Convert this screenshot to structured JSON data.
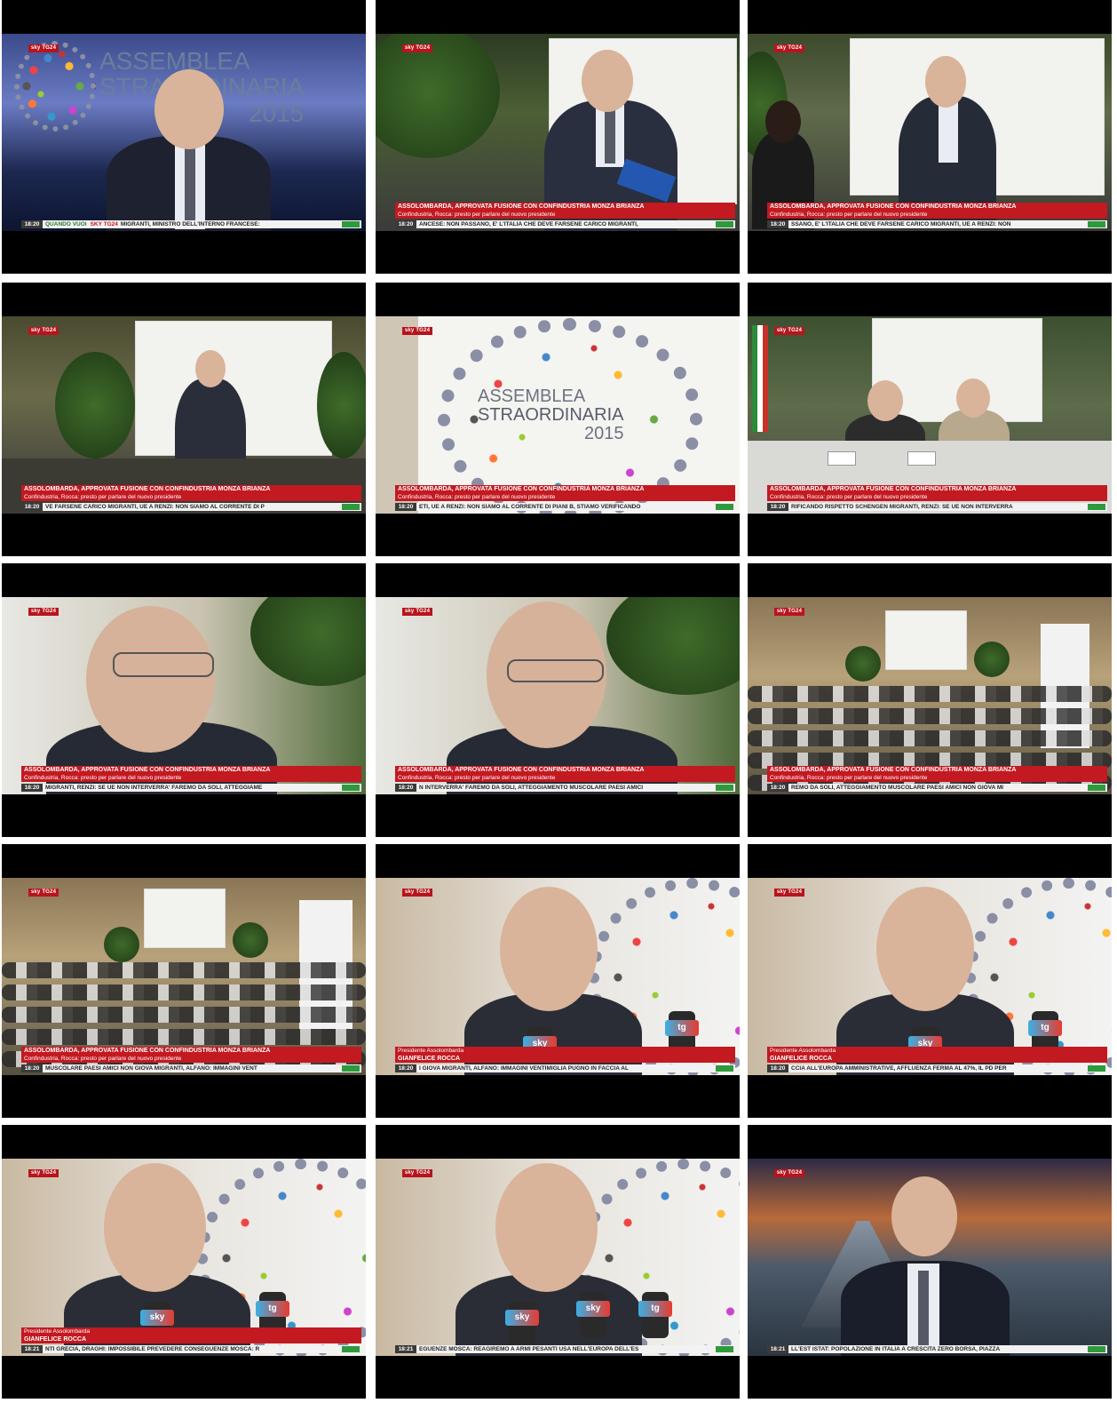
{
  "logo_text": "sky TG24",
  "headline": "ASSOLOMBARDA, APPROVATA FUSIONE CON CONFINDUSTRIA MONZA BRIANZA",
  "subline": "Confindustria, Rocca: presto per parlare del nuovo presidente",
  "name_caption": {
    "role": "Presidente Assolombarda",
    "name": "GIANFELICE ROCCA"
  },
  "banner": {
    "line1": "ASSEMBLEA",
    "line2": "STRAORDINARIA",
    "line3": "2015"
  },
  "frames": [
    {
      "time": "18:20",
      "ticker_pre": "QUANDO VUOI",
      "ticker_pre2": "SKY TG24",
      "ticker": "MIGRANTI, MINISTRO DELL'INTERNO FRANCESE:",
      "has_lower": false
    },
    {
      "time": "18:20",
      "ticker": "ANCESE: NON PASSANO, E' L'ITALIA CHE DEVE FARSENE CARICO   MIGRANTI,",
      "has_lower": true
    },
    {
      "time": "18:20",
      "ticker": "SSANO, E' L'ITALIA CHE DEVE FARSENE CARICO   MIGRANTI, UE A RENZI: NON",
      "has_lower": true
    },
    {
      "time": "18:20",
      "ticker": "VE FARSENE CARICO   MIGRANTI, UE A RENZI: NON SIAMO AL CORRENTE DI P",
      "has_lower": true
    },
    {
      "time": "18:20",
      "ticker": "ETI, UE A RENZI: NON SIAMO AL CORRENTE DI PIANI B, STIAMO VERIFICANDO",
      "has_lower": true
    },
    {
      "time": "18:20",
      "ticker": "RIFICANDO RISPETTO SCHENGEN   MIGRANTI, RENZI: SE UE NON INTERVERRA",
      "has_lower": true
    },
    {
      "time": "18:20",
      "ticker": "MIGRANTI, RENZI: SE UE NON INTERVERRA' FAREMO DA SOLI, ATTEGGIAME",
      "has_lower": true
    },
    {
      "time": "18:20",
      "ticker": "N INTERVERRA' FAREMO DA SOLI, ATTEGGIAMENTO MUSCOLARE PAESI AMICI",
      "has_lower": true
    },
    {
      "time": "18:20",
      "ticker": "REMO DA SOLI, ATTEGGIAMENTO MUSCOLARE PAESI AMICI NON GIOVA   MI",
      "has_lower": true
    },
    {
      "time": "18:20",
      "ticker": "MUSCOLARE PAESI AMICI NON GIOVA   MIGRANTI, ALFANO: IMMAGINI VENT",
      "has_lower": true
    },
    {
      "time": "18:20",
      "ticker": "I GIOVA   MIGRANTI, ALFANO: IMMAGINI VENTIMIGLIA PUGNO IN FACCIA AL",
      "has_name": true
    },
    {
      "time": "18:20",
      "ticker": "CCIA ALL'EUROPA   AMMINISTRATIVE, AFFLUENZA FERMA AL 47%, IL PD PER",
      "has_name": true
    },
    {
      "time": "18:21",
      "ticker": "NTI   GRECIA, DRAGHI: IMPOSSIBILE PREVEDERE CONSEGUENZE   MOSCA: R",
      "has_name": true
    },
    {
      "time": "18:21",
      "ticker": "EGUENZE   MOSCA: REAGIREMO A ARMI PESANTI USA NELL'EUROPA DELL'ES",
      "has_name": false
    },
    {
      "time": "18:21",
      "ticker": "LL'EST   ISTAT: POPOLAZIONE IN ITALIA A CRESCITA ZERO   BORSA, PIAZZA",
      "has_lower": false
    }
  ]
}
